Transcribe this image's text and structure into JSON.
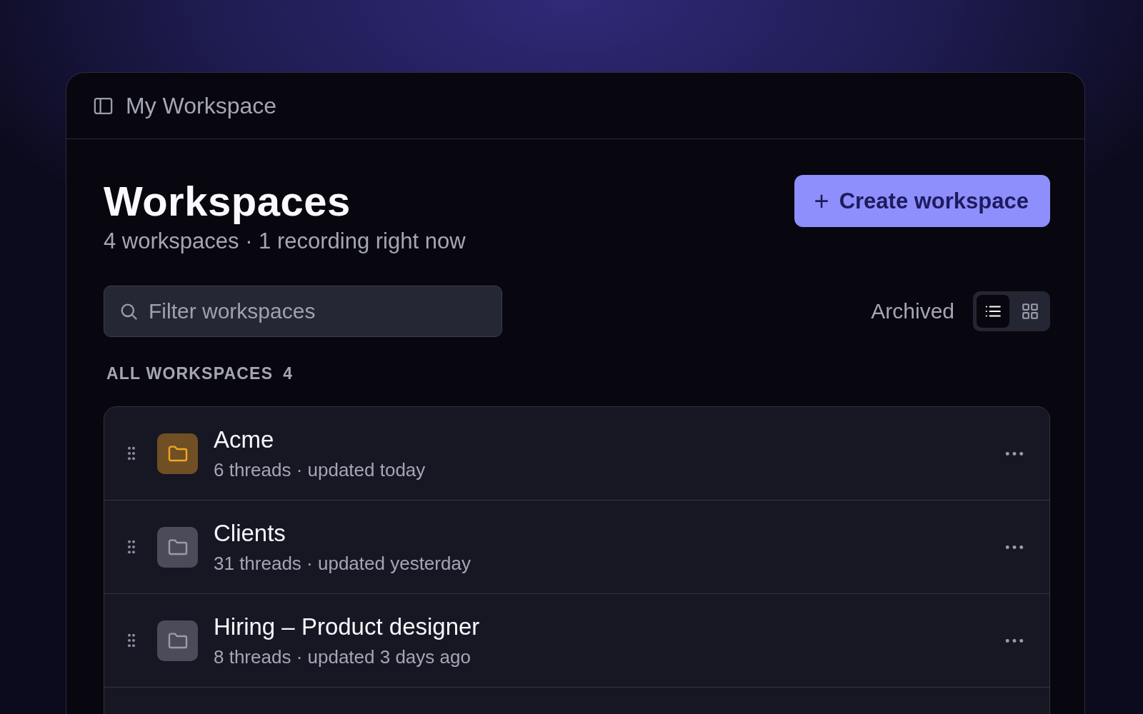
{
  "window": {
    "title": "My Workspace"
  },
  "header": {
    "title": "Workspaces",
    "subtitle": "4 workspaces · 1 recording right now",
    "create_button": {
      "icon": "+",
      "label": "Create workspace"
    }
  },
  "filter": {
    "placeholder": "Filter workspaces"
  },
  "archived": {
    "label": "Archived"
  },
  "view_toggle": [
    {
      "kind": "list",
      "selected": true
    },
    {
      "kind": "grid",
      "selected": false
    }
  ],
  "section": {
    "label": "ALL WORKSPACES",
    "count": "4"
  },
  "workspaces": [
    {
      "name": "Acme",
      "meta": "6 threads · updated today",
      "color": "#f5a524"
    },
    {
      "name": "Clients",
      "meta": "31 threads · updated yesterday",
      "color": "#9a9cab"
    },
    {
      "name": "Hiring – Product designer",
      "meta": "8 threads · updated 3 days ago",
      "color": "#9a9cab"
    }
  ]
}
